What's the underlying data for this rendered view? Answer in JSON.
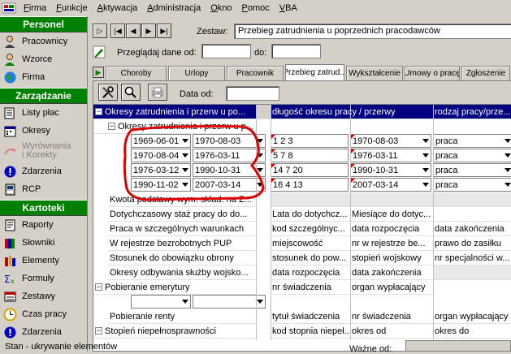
{
  "menu": {
    "items": [
      {
        "label": "Firma",
        "ul": "F",
        "rest": "irma"
      },
      {
        "label": "Funkcje",
        "ul": "F",
        "rest": "unkcje"
      },
      {
        "label": "Aktywacja",
        "ul": "A",
        "rest": "ktywacja"
      },
      {
        "label": "Administracja",
        "ul": "A",
        "rest": "dministracja"
      },
      {
        "label": "Okno",
        "ul": "O",
        "rest": "kno"
      },
      {
        "label": "Pomoc",
        "ul": "P",
        "rest": "omoc"
      },
      {
        "label": "VBA",
        "ul": "V",
        "rest": "BA"
      }
    ]
  },
  "sidebar": {
    "personel_header": "Personel",
    "personel_items": [
      {
        "label": "Pracownicy",
        "icon": "people-icon"
      },
      {
        "label": "Wzorce",
        "icon": "pattern-person-icon"
      },
      {
        "label": "Firma",
        "icon": "globe-icon"
      }
    ],
    "zarzadzanie_header": "Zarządzanie",
    "zarzadzanie_items": [
      {
        "label": "Listy płac",
        "icon": "payroll-icon"
      },
      {
        "label": "Okresy",
        "icon": "periods-icon"
      },
      {
        "label": "Wyrównania i Korekty",
        "line1": "Wyrównania",
        "line2": "i Korekty",
        "icon": "arrow-icon",
        "disabled": true
      },
      {
        "label": "Zdarzenia",
        "icon": "event-icon"
      },
      {
        "label": "RCP",
        "icon": "rcp-icon"
      }
    ],
    "kartoteki_header": "Kartoteki",
    "kartoteki_items": [
      {
        "label": "Raporty",
        "icon": "report-icon"
      },
      {
        "label": "Słowniki",
        "icon": "dictionary-icon"
      },
      {
        "label": "Elementy",
        "icon": "elements-icon"
      },
      {
        "label": "Formuły",
        "icon": "formula-icon"
      },
      {
        "label": "Zestawy",
        "icon": "sets-icon"
      },
      {
        "label": "Czas pracy",
        "icon": "clock-icon"
      },
      {
        "label": "Zdarzenia",
        "icon": "event-icon"
      }
    ]
  },
  "toolbar_top": {
    "zestaw_label": "Zestaw:",
    "zestaw_value": "Przebieg zatrudnienia u poprzednich pracodawców",
    "przegladaj_label": "Przeglądaj dane od:",
    "do_label": "do:"
  },
  "tabs": [
    "Choroby",
    "Urlopy",
    "Pracownik",
    "Przebieg zatrud...",
    "Wykształcenie",
    "Umowy o pracę",
    "Zgłoszenie"
  ],
  "panel": {
    "data_od_label": "Data od:"
  },
  "grid": {
    "headers": [
      "Okresy zatrudnienia i przerw u po...",
      "długość okresu pracy / przerwy",
      "rodzaj pracy/prze..."
    ],
    "subheader": "Okresy zatrudnienia i przerw u p...",
    "period_rows": [
      {
        "from": "1969-06-01",
        "to": "1970-08-03",
        "dlugosc": "1 2 3",
        "date": "1970-08-03",
        "rodzaj": "praca"
      },
      {
        "from": "1970-08-04",
        "to": "1976-03-11",
        "dlugosc": "5 7 8",
        "date": "1976-03-11",
        "rodzaj": "praca"
      },
      {
        "from": "1976-03-12",
        "to": "1990-10-31",
        "dlugosc": "14 7 20",
        "date": "1990-10-31",
        "rodzaj": "praca"
      },
      {
        "from": "1990-11-02",
        "to": "2007-03-14",
        "dlugosc": "16 4 13",
        "date": "2007-03-14",
        "rodzaj": "praca"
      }
    ],
    "info_rows": [
      {
        "label": "Kwota podstawy wym. skład. na Z...",
        "c1": "",
        "c2": "",
        "c3": ""
      },
      {
        "label": "Dotychczasowy staż pracy do do...",
        "c1": "Lata do dotychcz...",
        "c2": "Miesiące do dotyc...",
        "c3": ""
      },
      {
        "label": "Praca w szczególnych warunkach",
        "c1": "kod szczególnyc...",
        "c2": "data rozpoczęcia",
        "c3": "data zakończenia"
      },
      {
        "label": "W rejestrze bezrobotnych PUP",
        "c1": "miejscowość",
        "c2": "nr w rejestrze be...",
        "c3": "prawo do zasiłku"
      },
      {
        "label": "Stosunek do obowiązku obrony",
        "c1": "stosunek do pow...",
        "c2": "stopień wojskowy",
        "c3": "nr specjalności w..."
      },
      {
        "label": "Okresy odbywania służby wojsko...",
        "c1": "data rozpoczęcia",
        "c2": "data zakończenia",
        "c3": ""
      }
    ],
    "pobieranie_emerytury": "Pobieranie emerytury",
    "pobieranie_emerytury_c1": "nr świadczenia",
    "pobieranie_emerytury_c2": "organ wypłacający",
    "pobieranie_renty": "Pobieranie renty",
    "renty_c1": "tytuł świadczenia",
    "renty_c2": "nr świadczenia",
    "renty_c3": "organ wypłacający",
    "stopien": "Stopień niepełnosprawności",
    "stopien_c1": "kod stopnia niepeł...",
    "stopien_c2": "okres od",
    "stopien_c3": "okres do"
  },
  "status_text": "Stan - ukrywanie elementów",
  "wazne_od": "Ważne od:"
}
